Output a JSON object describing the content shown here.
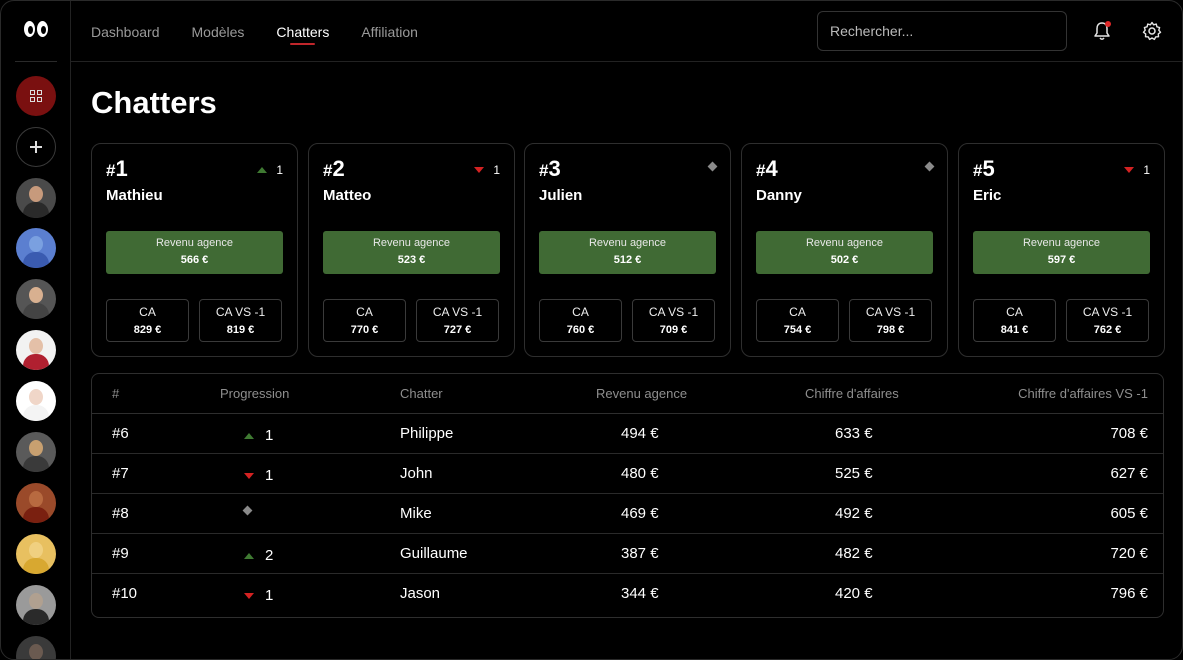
{
  "nav": {
    "items": [
      "Dashboard",
      "Modèles",
      "Chatters",
      "Affiliation"
    ],
    "active": "Chatters"
  },
  "search": {
    "placeholder": "Rechercher..."
  },
  "colors": {
    "accent": "#c0262b",
    "revenue_box": "#406a34",
    "trend_up": "#3f7a32",
    "trend_down": "#d42222",
    "trend_flat": "#8a8a8a",
    "sidebar_active": "#7a1010"
  },
  "icons": {
    "logo": "eyes-logo-icon",
    "grid": "grid-icon",
    "add": "plus-icon",
    "bell": "bell-icon",
    "settings": "gear-icon"
  },
  "page": {
    "title": "Chatters"
  },
  "cards": [
    {
      "hash": "#",
      "rank": "1",
      "trend": "up",
      "change": "1",
      "name": "Mathieu",
      "rev_label": "Revenu agence",
      "rev_value": "566 €",
      "ca_label": "CA",
      "ca_value": "829 €",
      "ca_prev_label": "CA VS -1",
      "ca_prev_value": "819 €"
    },
    {
      "hash": "#",
      "rank": "2",
      "trend": "down",
      "change": "1",
      "name": "Matteo",
      "rev_label": "Revenu agence",
      "rev_value": "523 €",
      "ca_label": "CA",
      "ca_value": "770 €",
      "ca_prev_label": "CA VS -1",
      "ca_prev_value": "727 €"
    },
    {
      "hash": "#",
      "rank": "3",
      "trend": "flat",
      "change": "",
      "name": "Julien",
      "rev_label": "Revenu agence",
      "rev_value": "512 €",
      "ca_label": "CA",
      "ca_value": "760 €",
      "ca_prev_label": "CA VS -1",
      "ca_prev_value": "709 €"
    },
    {
      "hash": "#",
      "rank": "4",
      "trend": "flat",
      "change": "",
      "name": "Danny",
      "rev_label": "Revenu agence",
      "rev_value": "502 €",
      "ca_label": "CA",
      "ca_value": "754 €",
      "ca_prev_label": "CA VS -1",
      "ca_prev_value": "798 €"
    },
    {
      "hash": "#",
      "rank": "5",
      "trend": "down",
      "change": "1",
      "name": "Eric",
      "rev_label": "Revenu agence",
      "rev_value": "597 €",
      "ca_label": "CA",
      "ca_value": "841 €",
      "ca_prev_label": "CA VS -1",
      "ca_prev_value": "762 €"
    }
  ],
  "table": {
    "headers": [
      "#",
      "Progression",
      "Chatter",
      "Revenu agence",
      "Chiffre d'affaires",
      "Chiffre d'affaires VS -1"
    ],
    "rows": [
      {
        "rank": "#6",
        "trend": "up",
        "change": "1",
        "chatter": "Philippe",
        "revenue": "494 €",
        "ca": "633 €",
        "ca_prev": "708 €"
      },
      {
        "rank": "#7",
        "trend": "down",
        "change": "1",
        "chatter": "John",
        "revenue": "480 €",
        "ca": "525 €",
        "ca_prev": "627 €"
      },
      {
        "rank": "#8",
        "trend": "flat",
        "change": "",
        "chatter": "Mike",
        "revenue": "469 €",
        "ca": "492 €",
        "ca_prev": "605 €"
      },
      {
        "rank": "#9",
        "trend": "up",
        "change": "2",
        "chatter": "Guillaume",
        "revenue": "387 €",
        "ca": "482 €",
        "ca_prev": "720 €"
      },
      {
        "rank": "#10",
        "trend": "down",
        "change": "1",
        "chatter": "Jason",
        "revenue": "344 €",
        "ca": "420 €",
        "ca_prev": "796 €"
      }
    ]
  },
  "sidebar": {
    "avatars": [
      {
        "skin": "#c79a7c",
        "cloth": "#2a2a2a",
        "bg": "#4a4a4a"
      },
      {
        "skin": "#7aa0e0",
        "cloth": "#3a5bb0",
        "bg": "#5b7fd0"
      },
      {
        "skin": "#d8b090",
        "cloth": "#444444",
        "bg": "#555555"
      },
      {
        "skin": "#e4c0a8",
        "cloth": "#b02030",
        "bg": "#f2f2f2"
      },
      {
        "skin": "#f0d6c8",
        "cloth": "#f4f4f4",
        "bg": "#ffffff"
      },
      {
        "skin": "#c8a070",
        "cloth": "#3a3a3a",
        "bg": "#5a5a5a"
      },
      {
        "skin": "#b86a40",
        "cloth": "#7a2010",
        "bg": "#9a4a2a"
      },
      {
        "skin": "#f0d080",
        "cloth": "#d8a830",
        "bg": "#e8c060"
      },
      {
        "skin": "#b0a090",
        "cloth": "#2a2a2a",
        "bg": "#9a9a9a"
      },
      {
        "skin": "#6a5a50",
        "cloth": "#1a1a1a",
        "bg": "#3a3a3a"
      }
    ]
  }
}
